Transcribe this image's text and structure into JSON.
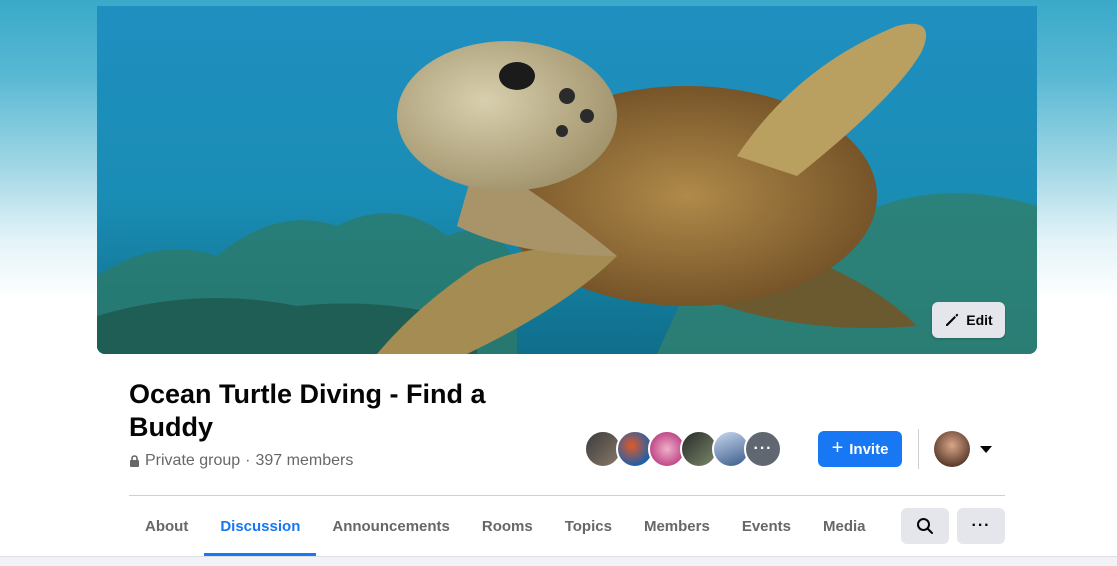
{
  "cover": {
    "edit_label": "Edit"
  },
  "group": {
    "name": "Ocean Turtle Diving - Find a Buddy",
    "privacy": "Private group",
    "separator": "·",
    "members_text": "397 members"
  },
  "member_preview": {
    "more_label": "···"
  },
  "actions": {
    "invite_label": "Invite"
  },
  "tabs": [
    {
      "label": "About",
      "active": false
    },
    {
      "label": "Discussion",
      "active": true
    },
    {
      "label": "Announcements",
      "active": false
    },
    {
      "label": "Rooms",
      "active": false
    },
    {
      "label": "Topics",
      "active": false
    },
    {
      "label": "Members",
      "active": false
    },
    {
      "label": "Events",
      "active": false
    },
    {
      "label": "Media",
      "active": false
    }
  ],
  "toolbar": {
    "more_label": "···"
  },
  "colors": {
    "accent": "#1877f2",
    "button_gray": "#e4e6eb",
    "muted_text": "#65676b"
  },
  "icons": [
    "pencil-icon",
    "lock-icon",
    "plus-icon",
    "search-icon",
    "more-icon",
    "chevron-down-icon"
  ]
}
